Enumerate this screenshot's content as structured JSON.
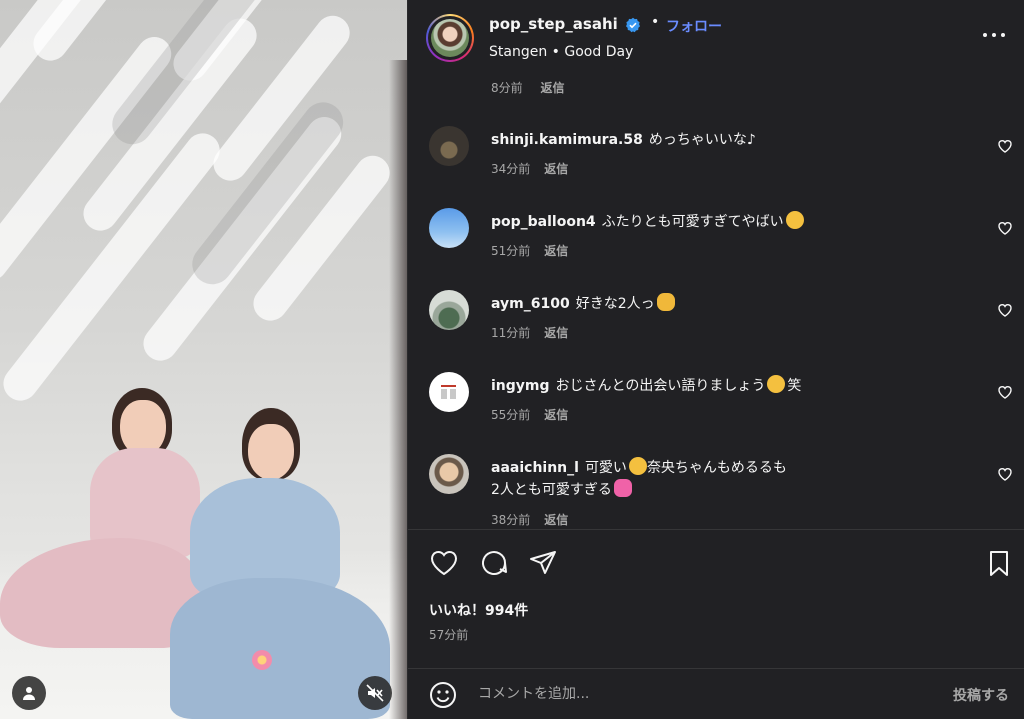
{
  "post": {
    "username": "pop_step_asahi",
    "follow_label": "フォロー",
    "dot": "•",
    "location": "Stangen",
    "subline_sep": "•",
    "audio": "Good Day"
  },
  "comments": {
    "clipped_meta_time": "8分前",
    "clipped_meta_reply": "返信",
    "items": [
      {
        "user": "shinji.kamimura.58",
        "text": "めっちゃいいな♪",
        "line2": "",
        "emoji": "",
        "time": "34分前",
        "reply": "返信"
      },
      {
        "user": "pop_balloon4",
        "text": "ふたりとも可愛すぎてやばい",
        "line2": "",
        "emoji": "face-hugging",
        "time": "51分前",
        "reply": "返信"
      },
      {
        "user": "aym_6100",
        "text": "好きな2人っ",
        "line2": "",
        "emoji": "heart-hands",
        "time": "11分前",
        "reply": "返信"
      },
      {
        "user": "ingymg",
        "text": "おじさんとの出会い語りましょう",
        "line2": "",
        "emoji": "shushing-face",
        "suffix": "笑",
        "time": "55分前",
        "reply": "返信"
      },
      {
        "user": "aaaichinn_l",
        "text": "可愛い",
        "text_after": "奈央ちゃんもめるるも",
        "line2": "2人とも可愛すぎる",
        "emoji": "heart-eyes",
        "emoji2": "sparkling-heart",
        "time": "38分前",
        "reply": "返信"
      }
    ]
  },
  "footer": {
    "likes": "いいね！994件",
    "time": "57分前",
    "comment_placeholder": "コメントを追加...",
    "post_label": "投稿する"
  },
  "colors": {
    "panel_bg": "#212124",
    "link_blue": "#6a8cff",
    "secondary_text": "#a8a8a8",
    "verified_blue": "#3897f0"
  }
}
